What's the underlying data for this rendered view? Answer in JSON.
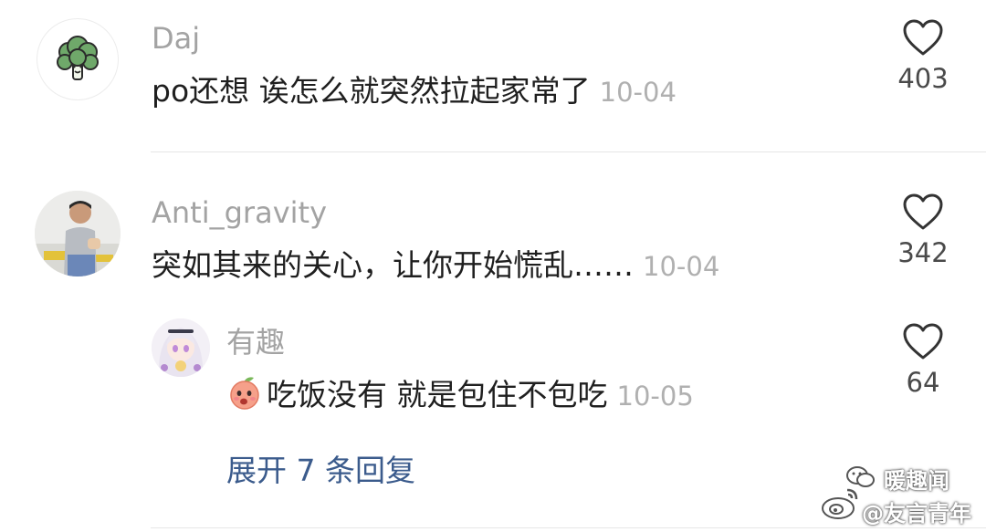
{
  "comments": [
    {
      "username": "Daj",
      "text": "po还想 诶怎么就突然拉起家常了",
      "time": "10-04",
      "likes": "403",
      "avatar_icon": "broccoli-icon"
    },
    {
      "username": "Anti_gravity",
      "text": "突如其来的关心，让你开始慌乱……",
      "time": "10-04",
      "likes": "342",
      "avatar_icon": "person-photo"
    }
  ],
  "reply": {
    "username": "有趣",
    "text": "吃饭没有 就是包住不包吃",
    "time": "10-05",
    "likes": "64",
    "emoji": "peach-emoji",
    "avatar_icon": "anime-girl-avatar"
  },
  "expand_replies_label": "展开 7 条回复",
  "watermark": {
    "line1": "暖趣闻",
    "line2": "@友言青年"
  },
  "colors": {
    "username": "#a3a3a3",
    "text": "#1f1f1f",
    "time": "#b0b0b0",
    "link": "#3b5b8c"
  }
}
